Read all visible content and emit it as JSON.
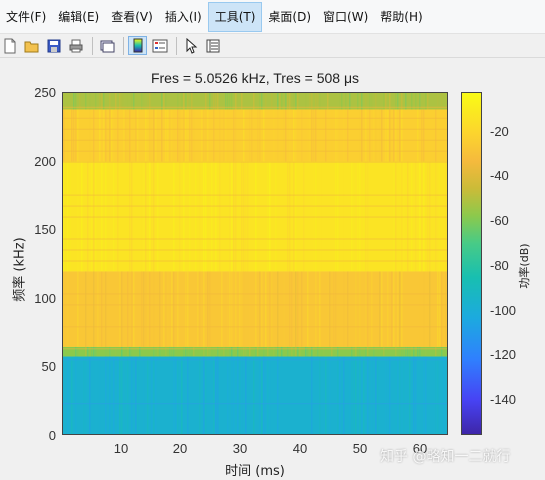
{
  "menubar": {
    "items": [
      "文件(F)",
      "编辑(E)",
      "查看(V)",
      "插入(I)",
      "工具(T)",
      "桌面(D)",
      "窗口(W)",
      "帮助(H)"
    ]
  },
  "toolbar": {
    "icons": [
      "new-file-icon",
      "open-folder-icon",
      "save-icon",
      "print-icon",
      "link-plot-icon",
      "insert-colorbar-icon",
      "insert-legend-icon",
      "pointer-icon",
      "property-inspector-icon"
    ]
  },
  "colors": {
    "yellow": "#f9e231",
    "orange": "#f2b73c",
    "cyan": "#18b1d7",
    "blue": "#2c9ee8"
  },
  "chart_data": {
    "type": "heatmap",
    "title": "Fres = 5.0526 kHz, Tres = 508 μs",
    "xlabel": "时间 (ms)",
    "ylabel": "频率 (kHz)",
    "xlim": [
      0.5,
      65
    ],
    "ylim": [
      0,
      250
    ],
    "x_ticks": [
      10,
      20,
      30,
      40,
      50,
      60
    ],
    "y_ticks": [
      0,
      50,
      100,
      150,
      200,
      250
    ],
    "colorbar": {
      "label": "功率(dB)",
      "range": [
        -155,
        -10
      ],
      "ticks": [
        -20,
        -40,
        -60,
        -80,
        -100,
        -120,
        -140
      ]
    },
    "frequency_bands": [
      {
        "from": 0,
        "to": 58,
        "level_db": -95
      },
      {
        "from": 58,
        "to": 65,
        "level_db": -60
      },
      {
        "from": 65,
        "to": 120,
        "level_db": -35
      },
      {
        "from": 120,
        "to": 200,
        "level_db": -22
      },
      {
        "from": 200,
        "to": 238,
        "level_db": -32
      },
      {
        "from": 238,
        "to": 250,
        "level_db": -55
      }
    ]
  },
  "watermark": "知乎 @略知一二就行"
}
